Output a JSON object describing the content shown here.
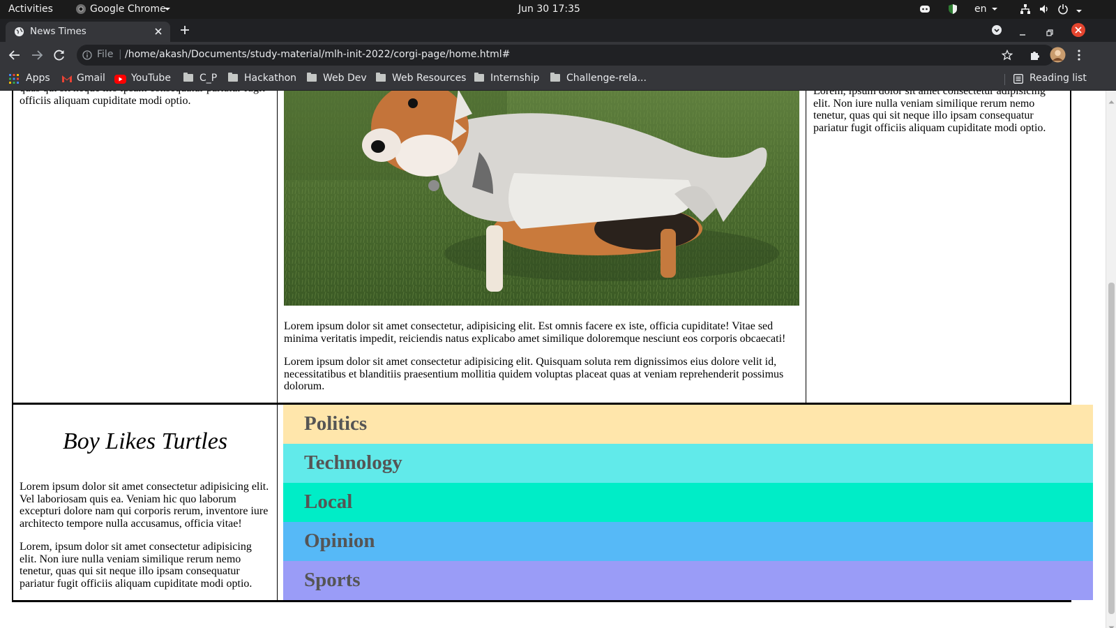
{
  "system_bar": {
    "activities": "Activities",
    "app_name": "Google Chrome",
    "datetime": "Jun 30  17:35",
    "lang": "en",
    "icons": [
      "discord-icon",
      "shield-icon",
      "network-icon",
      "volume-icon",
      "power-icon"
    ]
  },
  "browser": {
    "tab_title": "News Times",
    "url_scheme": "File",
    "url": "/home/akash/Documents/study-material/mlh-init-2022/corgi-page/home.html#",
    "bookmarks": [
      "Apps",
      "Gmail",
      "YouTube",
      "C_P",
      "Hackathon",
      "Web Dev",
      "Web Resources",
      "Internship",
      "Challenge-rela..."
    ],
    "reading_list": "Reading list"
  },
  "page": {
    "left_top_text_partial": "quas qui sit neque illo ipsam consequatur pariatur fugit officiis aliquam cupiditate modi optio.",
    "center_paragraphs": [
      "Lorem ipsum dolor sit amet consectetur, adipisicing elit. Est omnis facere ex iste, officia cupiditate! Vitae sed minima veritatis impedit, reiciendis natus explicabo amet similique doloremque nesciunt eos corporis obcaecati!",
      "Lorem ipsum dolor sit amet consectetur adipisicing elit. Quisquam soluta rem dignissimos eius dolore velit id, necessitatibus et blanditiis praesentium mollitia quidem voluptas placeat quas at veniam reprehenderit possimus dolorum."
    ],
    "right_top_text": "Lorem, ipsum dolor sit amet consectetur adipisicing elit. Non iure nulla veniam similique rerum nemo tenetur, quas qui sit neque illo ipsam consequatur pariatur fugit officiis aliquam cupiditate modi optio.",
    "feature": {
      "title": "Boy Likes Turtles",
      "paragraphs": [
        "Lorem ipsum dolor sit amet consectetur adipisicing elit. Vel laboriosam quis ea. Veniam hic quo laborum excepturi dolore nam qui corporis rerum, inventore iure architecto tempore nulla accusamus, officia vitae!",
        "Lorem, ipsum dolor sit amet consectetur adipisicing elit. Non iure nulla veniam similique rerum nemo tenetur, quas qui sit neque illo ipsam consequatur pariatur fugit officiis aliquam cupiditate modi optio."
      ]
    },
    "categories": [
      {
        "label": "Politics",
        "color": "#ffe6ab"
      },
      {
        "label": "Technology",
        "color": "#61eaea"
      },
      {
        "label": "Local",
        "color": "#00edc7"
      },
      {
        "label": "Opinion",
        "color": "#56b9f7"
      },
      {
        "label": "Sports",
        "color": "#9a9cf7"
      }
    ]
  },
  "colors": {
    "system_bar": "#1b1b1b",
    "chrome_frame": "#202124",
    "chrome_toolbar": "#35363a",
    "close_button": "#e5452f"
  }
}
